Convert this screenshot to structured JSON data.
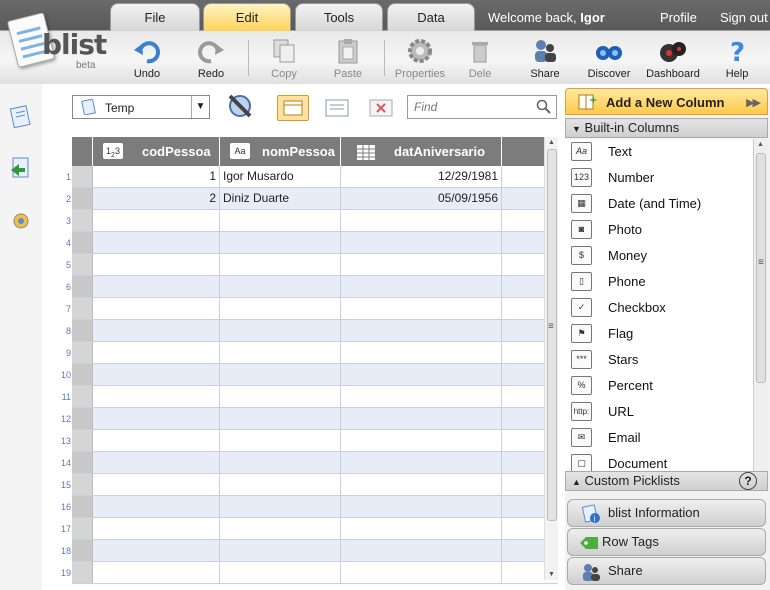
{
  "app": {
    "logo_text": "blist",
    "logo_sub": "beta"
  },
  "tabs": [
    {
      "label": "File"
    },
    {
      "label": "Edit"
    },
    {
      "label": "Tools"
    },
    {
      "label": "Data"
    }
  ],
  "active_tab": "Edit",
  "header": {
    "welcome_prefix": "Welcome back,",
    "user_name": "Igor",
    "profile_label": "Profile",
    "signout_label": "Sign out"
  },
  "toolbar": {
    "undo": "Undo",
    "redo": "Redo",
    "copy": "Copy",
    "paste": "Paste",
    "properties": "Properties",
    "delete": "Dele",
    "share": "Share",
    "discover": "Discover",
    "dashboard": "Dashboard",
    "help": "Help"
  },
  "view": {
    "select_value": "Temp",
    "find_placeholder": "Find"
  },
  "grid": {
    "columns": [
      {
        "name": "codPessoa",
        "type_icon": "123"
      },
      {
        "name": "nomPessoa",
        "type_icon": "Aa"
      },
      {
        "name": "datAniversario",
        "type_icon": "calendar"
      }
    ],
    "rows": [
      {
        "n": "1",
        "codPessoa": "1",
        "nomPessoa": "Igor Musardo",
        "datAniversario": "12/29/1981"
      },
      {
        "n": "2",
        "codPessoa": "2",
        "nomPessoa": "Diniz Duarte",
        "datAniversario": "05/09/1956"
      },
      {
        "n": "3"
      },
      {
        "n": "4"
      },
      {
        "n": "5"
      },
      {
        "n": "6"
      },
      {
        "n": "7"
      },
      {
        "n": "8"
      },
      {
        "n": "9"
      },
      {
        "n": "10"
      },
      {
        "n": "11"
      },
      {
        "n": "12"
      },
      {
        "n": "13"
      },
      {
        "n": "14"
      },
      {
        "n": "15"
      },
      {
        "n": "16"
      },
      {
        "n": "17"
      },
      {
        "n": "18"
      },
      {
        "n": "19"
      }
    ]
  },
  "panel": {
    "add_column": "Add a New Column",
    "builtin_header": "Built-in Columns",
    "column_types": [
      {
        "label": "Text",
        "icon": "Aa"
      },
      {
        "label": "Number",
        "icon": "123"
      },
      {
        "label": "Date (and Time)",
        "icon": "calendar"
      },
      {
        "label": "Photo",
        "icon": "camera"
      },
      {
        "label": "Money",
        "icon": "$"
      },
      {
        "label": "Phone",
        "icon": "phone"
      },
      {
        "label": "Checkbox",
        "icon": "check"
      },
      {
        "label": "Flag",
        "icon": "flag"
      },
      {
        "label": "Stars",
        "icon": "***"
      },
      {
        "label": "Percent",
        "icon": "%"
      },
      {
        "label": "URL",
        "icon": "http:"
      },
      {
        "label": "Email",
        "icon": "envelope"
      },
      {
        "label": "Document",
        "icon": "doc"
      }
    ],
    "custom_header": "Custom Picklists",
    "help_glyph": "?",
    "bottom_buttons": [
      {
        "label": "blist Information"
      },
      {
        "label": "Row Tags"
      },
      {
        "label": "Share"
      }
    ]
  },
  "colors": {
    "active_tab": "#ffd25a",
    "header_gray": "#7c7c7c",
    "row_alt": "#e8ecf7",
    "row_number": "#5a7ab8"
  }
}
